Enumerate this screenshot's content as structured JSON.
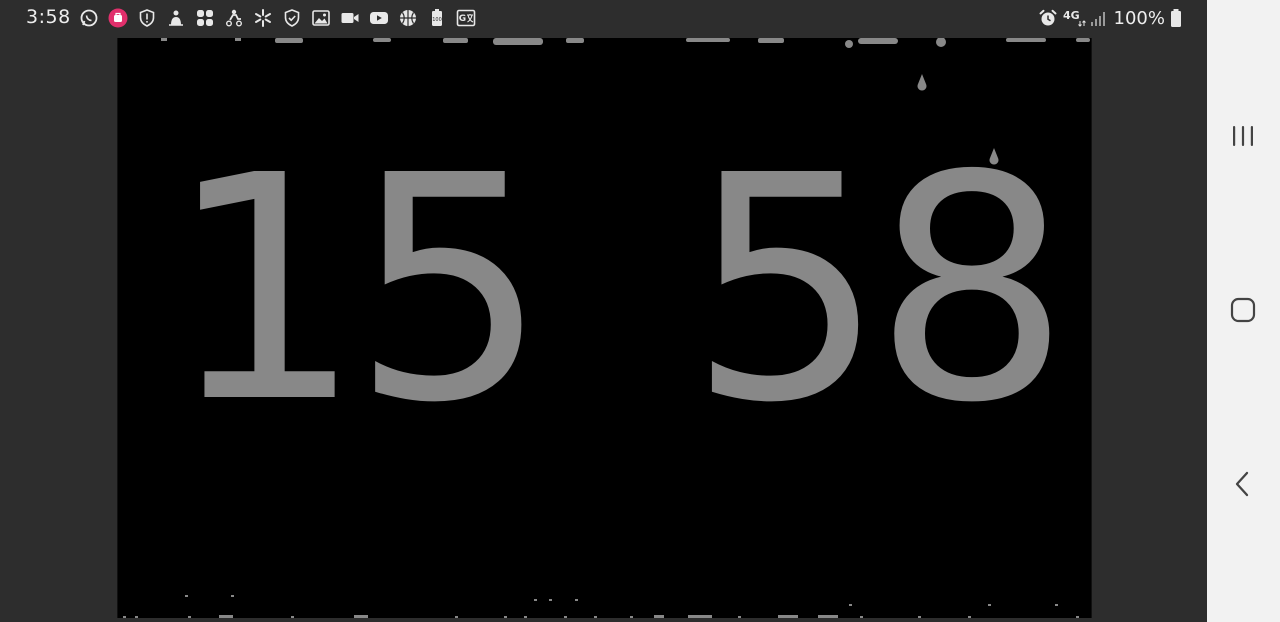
{
  "status_bar": {
    "time": "3:58",
    "battery": "100%",
    "network": "4G",
    "notification_icons": [
      "whatsapp-icon",
      "instagram-icon",
      "shield-alert-icon",
      "app-icon",
      "grid-apps-icon",
      "delivery-icon",
      "walmart-spark-icon",
      "shield-check-icon",
      "gallery-icon",
      "video-camera-icon",
      "youtube-icon",
      "basketball-icon",
      "battery-100-icon",
      "translate-icon"
    ],
    "system_icons": [
      "alarm-icon",
      "network-4g-icon",
      "signal-icon",
      "battery-icon"
    ]
  },
  "clock": {
    "hours": "15",
    "minutes": "58"
  },
  "nav_bar": {
    "buttons": [
      "recents-icon",
      "home-icon",
      "back-icon"
    ]
  },
  "colors": {
    "digit": "#888888",
    "canvas": "#000000",
    "frame": "#2d2d2d",
    "navbar": "#f2f2f2"
  }
}
